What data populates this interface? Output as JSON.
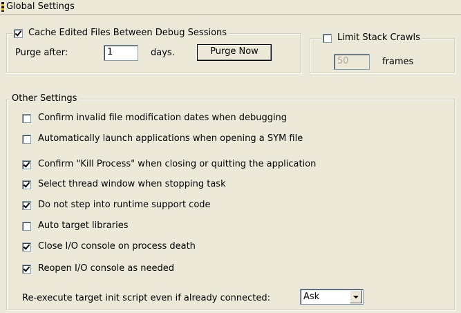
{
  "header": {
    "title": "Global Settings"
  },
  "cache_group": {
    "label": "Cache Edited Files Between Debug Sessions",
    "checked": true,
    "purge_label": "Purge after:",
    "purge_value": "1",
    "days_label": "days.",
    "purge_button": "Purge Now"
  },
  "stack_group": {
    "label": "Limit Stack Crawls",
    "checked": false,
    "frames_value": "50",
    "frames_label": "frames"
  },
  "other_settings": {
    "title": "Other Settings",
    "items": [
      {
        "label": "Confirm invalid file modification dates when debugging",
        "checked": false
      },
      {
        "label": "Automatically launch applications when opening a SYM file",
        "checked": false
      },
      {
        "label": "Confirm \"Kill Process\" when closing or quitting the application",
        "checked": true
      },
      {
        "label": "Select thread window when stopping task",
        "checked": true
      },
      {
        "label": "Do not step into runtime support code",
        "checked": true
      },
      {
        "label": "Auto target libraries",
        "checked": false
      },
      {
        "label": "Close I/O console on process death",
        "checked": true
      },
      {
        "label": "Reopen I/O console as needed",
        "checked": true
      }
    ],
    "reexecute_label": "Re-execute target init script even if already connected:",
    "reexecute_value": "Ask"
  },
  "icons": {
    "title": "settings-panel-icon",
    "dropdown": "chevron-down-icon",
    "checkbox": "checkbox-icon"
  }
}
